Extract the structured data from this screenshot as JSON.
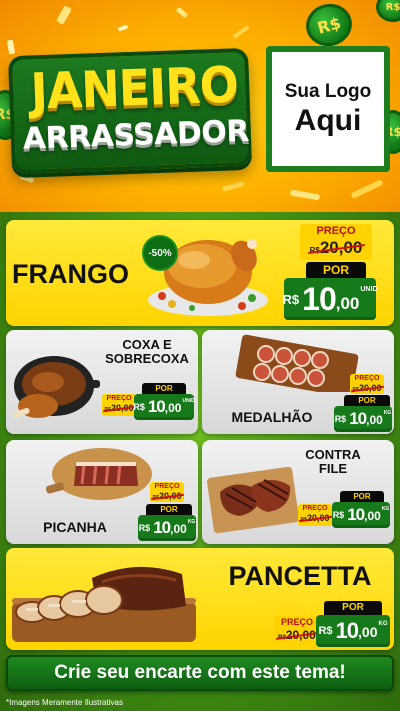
{
  "header": {
    "title_line1": "JANEIRO",
    "title_line2": "ARRASSADOR",
    "logo_line1": "Sua Logo",
    "logo_line2": "Aqui",
    "coin_symbol": "R$"
  },
  "colors": {
    "header_yellow": "#ffc20a",
    "brand_green": "#167a1a",
    "card_yellow": "#ffe21a",
    "price_label_red": "#b31111"
  },
  "products": {
    "frango": {
      "name": "FRANGO",
      "discount": "-50%",
      "preco_label": "PREÇO",
      "old_price": "20,00",
      "old_currency": "R$",
      "por_label": "POR",
      "currency": "R$",
      "price_int": "10",
      "price_cents": ",00",
      "unit": "UNID"
    },
    "coxa": {
      "name_line1": "COXA E",
      "name_line2": "SOBRECOXA",
      "preco_label": "PREÇO",
      "old_price": "20,00",
      "old_currency": "R$",
      "por_label": "POR",
      "currency": "R$",
      "price_int": "10",
      "price_cents": ",00",
      "unit": "UNID"
    },
    "medalhao": {
      "name": "MEDALHÃO",
      "preco_label": "PREÇO",
      "old_price": "20,00",
      "old_currency": "R$",
      "por_label": "POR",
      "currency": "R$",
      "price_int": "10",
      "price_cents": ",00",
      "unit": "KG"
    },
    "picanha": {
      "name": "PICANHA",
      "preco_label": "PREÇO",
      "old_price": "20,00",
      "old_currency": "R$",
      "por_label": "POR",
      "currency": "R$",
      "price_int": "10",
      "price_cents": ",00",
      "unit": "KG"
    },
    "contrafile": {
      "name_line1": "CONTRA",
      "name_line2": "FILE",
      "preco_label": "PREÇO",
      "old_price": "20,00",
      "old_currency": "R$",
      "por_label": "POR",
      "currency": "R$",
      "price_int": "10",
      "price_cents": ",00",
      "unit": "KG"
    },
    "pancetta": {
      "name": "PANCETTA",
      "preco_label": "PREÇO",
      "old_price": "20,00",
      "old_currency": "R$",
      "por_label": "POR",
      "currency": "R$",
      "price_int": "10",
      "price_cents": ",00",
      "unit": "KG"
    }
  },
  "footer": {
    "cta": "Crie seu encarte com este tema!",
    "disclaimer": "*Imagens Meramente Ilustrativas"
  }
}
